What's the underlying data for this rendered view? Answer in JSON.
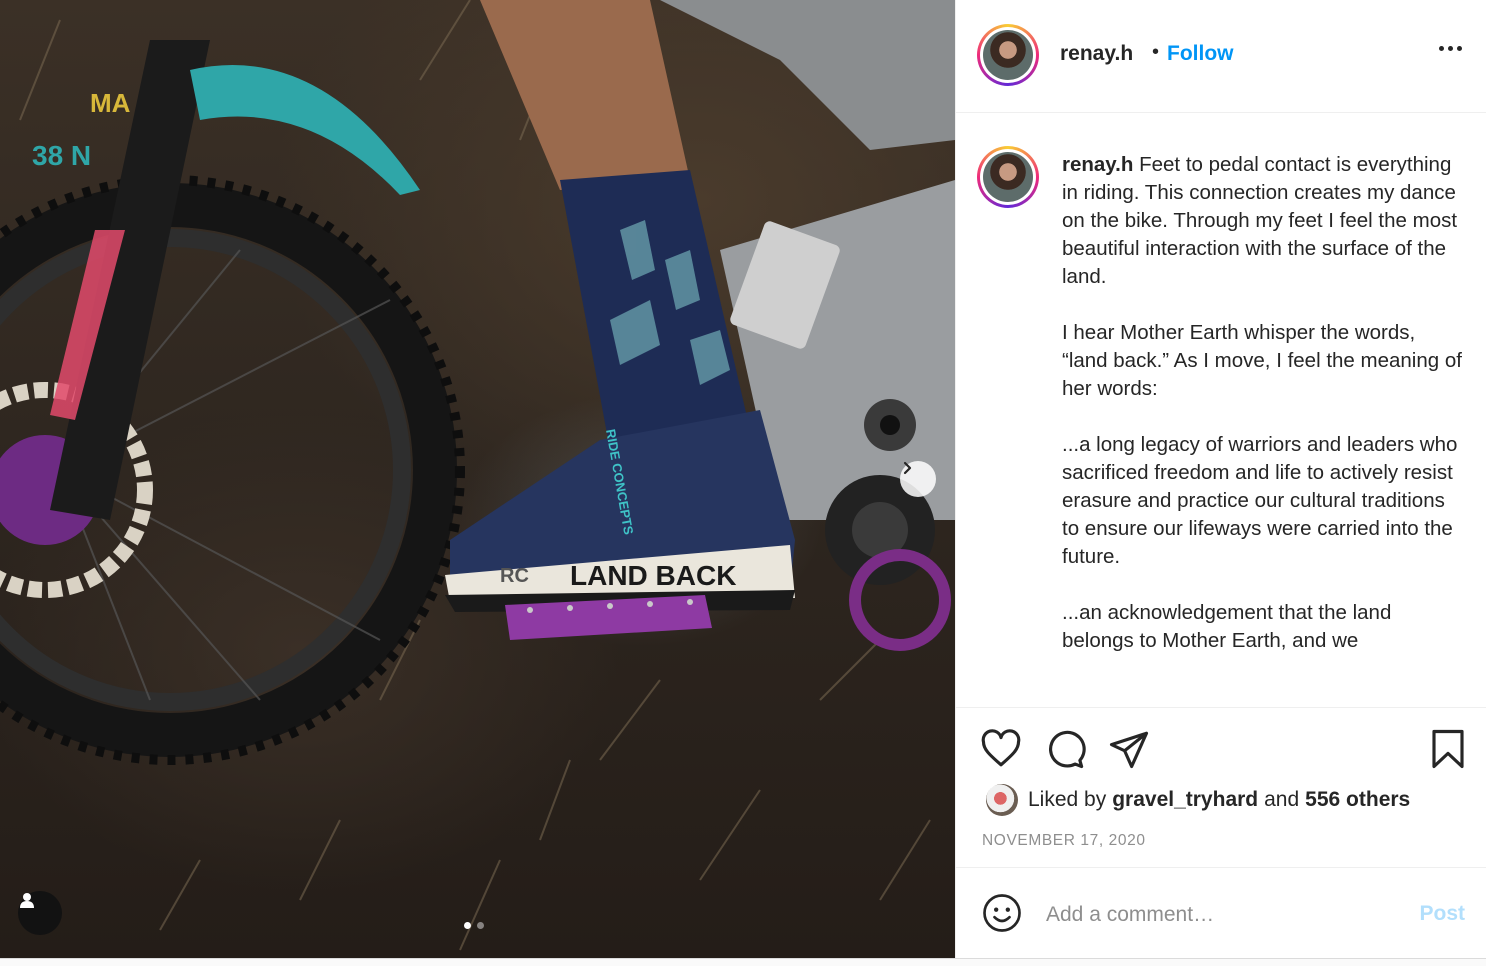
{
  "post": {
    "username": "renay.h",
    "follow_separator": "•",
    "follow_label": "Follow",
    "more_icon": "more-horizontal-icon"
  },
  "photo": {
    "shoe_text": "LAND BACK",
    "shoe_brand": "RIDE CONCEPTS",
    "shoe_logo": "RC",
    "carousel_count": 2,
    "carousel_active": 1
  },
  "caption": {
    "username": "renay.h",
    "paragraphs": [
      "Feet to pedal contact is everything in riding. This connection creates my dance on the bike. Through my feet I feel the most beautiful interaction with the surface of the land.",
      "I hear Mother Earth whisper the words, “land back.” As I move, I feel the meaning of her words:",
      "...a long legacy of warriors and leaders who sacrificed freedom and life to actively resist erasure and practice our cultural traditions to ensure our lifeways were carried into the future.",
      "...an acknowledgement that the land belongs to Mother Earth, and we"
    ]
  },
  "likes": {
    "prefix": "Liked by",
    "user": "gravel_tryhard",
    "joiner": "and",
    "others": "556 others"
  },
  "date": "NOVEMBER 17, 2020",
  "comment": {
    "placeholder": "Add a comment…",
    "post_label": "Post"
  },
  "colors": {
    "accent": "#0095f6",
    "post_disabled": "#b2dffc",
    "muted": "#8e8e8e"
  }
}
